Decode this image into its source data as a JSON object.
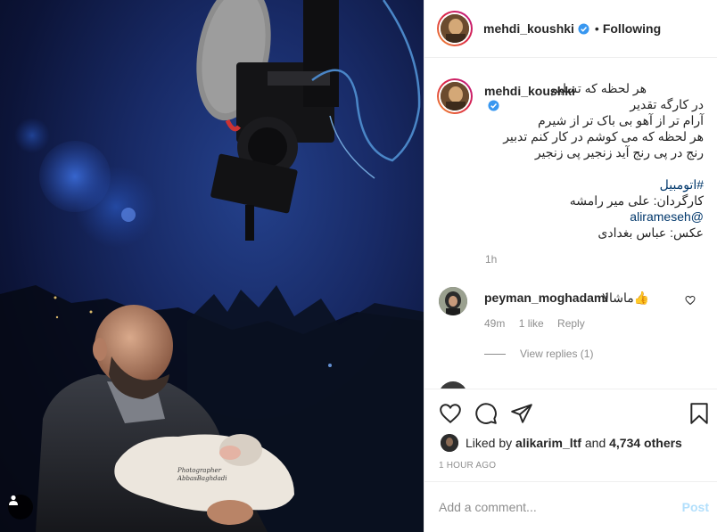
{
  "post": {
    "author": "mehdi_koushki",
    "separator": "•",
    "follow_status": "Following",
    "photo_credit": [
      "Photographer",
      "AbbasBaghdadi"
    ]
  },
  "caption": {
    "author": "mehdi_koushki",
    "lines": [
      "هر لحظه که تسلیم",
      "در کارگه تقدیر",
      "آرام تر از آهو بی باک تر از شیرم",
      "هر لحظه که می کوشم در کار کنم تدبیر",
      "رنج در پی رنج آید زنجیر پی زنجیر",
      "",
      "#اتومبیل",
      "کارگردان: علی میر رامشه",
      "@alirameseh",
      "عکس: عباس بغدادی"
    ],
    "time": "1h"
  },
  "comments": [
    {
      "user": "peyman_moghadami",
      "text": "ماشالا👍",
      "time": "49m",
      "likes": "1 like",
      "reply": "Reply",
      "view_replies": "View replies (1)"
    }
  ],
  "likes": {
    "prefix": "Liked by",
    "user": "alikarim_ltf",
    "and": "and",
    "others": "4,734 others"
  },
  "timestamp": "1 HOUR AGO",
  "comment_box": {
    "placeholder": "Add a comment...",
    "post_label": "Post"
  },
  "colors": {
    "link": "#00376b",
    "verified": "#3897f0",
    "post_disabled": "#b2dffc",
    "muted": "#8e8e8e"
  },
  "icons": [
    "verified-icon",
    "heart-icon",
    "comment-icon",
    "share-icon",
    "bookmark-icon",
    "user-tag-icon"
  ]
}
